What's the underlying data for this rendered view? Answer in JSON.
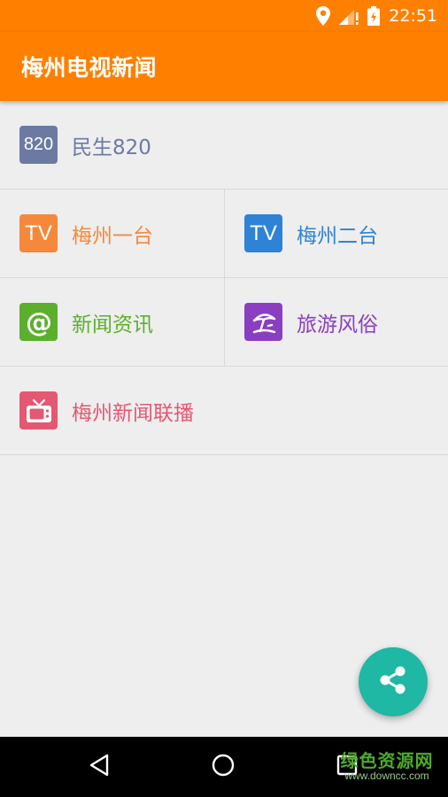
{
  "status_bar": {
    "time": "22:51",
    "icons": [
      "location-icon",
      "signal-icon",
      "battery-icon"
    ]
  },
  "toolbar": {
    "title": "梅州电视新闻"
  },
  "menu": {
    "minsheng": {
      "badge": "820",
      "label": "民生820",
      "color": "#6C7AA3"
    },
    "channel1": {
      "badge": "TV",
      "label": "梅州一台",
      "color": "#F5883B"
    },
    "channel2": {
      "badge": "TV",
      "label": "梅州二台",
      "color": "#2E83D6"
    },
    "news": {
      "icon": "at-sign-icon",
      "label": "新闻资讯",
      "color": "#5BAF2D"
    },
    "travel": {
      "icon": "beach-umbrella-icon",
      "label": "旅游风俗",
      "color": "#8A3FC2"
    },
    "broadcast": {
      "icon": "tv-icon",
      "label": "梅州新闻联播",
      "color": "#E35872"
    }
  },
  "fab": {
    "icon": "share-icon",
    "color": "#1EB8A4"
  },
  "nav_bar": {
    "icons": [
      "back-icon",
      "home-icon",
      "recents-icon"
    ]
  },
  "watermark": {
    "line1": "绿色资源网",
    "line2": "www.downcc.com"
  }
}
